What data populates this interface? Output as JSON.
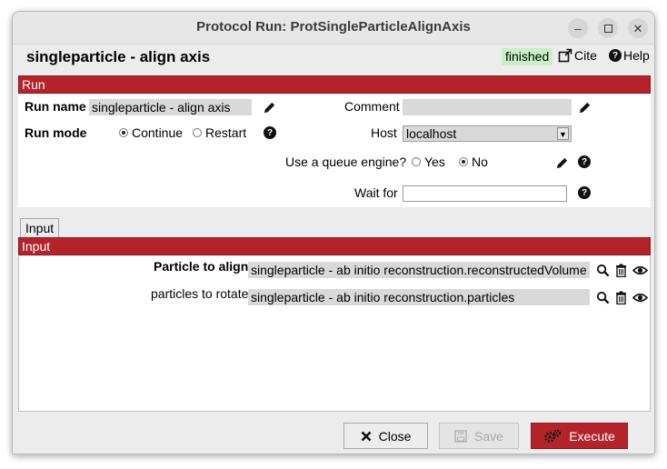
{
  "window": {
    "title": "Protocol Run: ProtSingleParticleAlignAxis",
    "controls": [
      "minimize-icon",
      "maximize-icon",
      "close-icon"
    ]
  },
  "header": {
    "protocol_title": "singleparticle - align axis",
    "status": "finished",
    "cite_label": "Cite",
    "help_label": "Help",
    "status_color": "#c8f0c4"
  },
  "run_section": {
    "title": "Run",
    "run_name_label": "Run name",
    "run_name_value": "singleparticle - align axis",
    "comment_label": "Comment",
    "comment_value": "",
    "run_mode_label": "Run mode",
    "run_mode_options": [
      "Continue",
      "Restart"
    ],
    "run_mode_selected": "Continue",
    "host_label": "Host",
    "host_value": "localhost",
    "queue_label": "Use a queue engine?",
    "queue_options": [
      "Yes",
      "No"
    ],
    "queue_selected": "No",
    "wait_for_label": "Wait for",
    "wait_for_value": ""
  },
  "tabs": [
    {
      "label": "Input"
    }
  ],
  "input_section": {
    "title": "Input",
    "params": [
      {
        "label": "Particle to align",
        "value": "singleparticle - ab initio reconstruction.reconstructedVolume"
      },
      {
        "label": "particles to rotate",
        "value": "singleparticle - ab initio reconstruction.particles"
      }
    ]
  },
  "footer": {
    "close_label": "Close",
    "save_label": "Save",
    "execute_label": "Execute"
  },
  "colors": {
    "accent": "#b2232a",
    "field_bg": "#d9d9d9"
  }
}
